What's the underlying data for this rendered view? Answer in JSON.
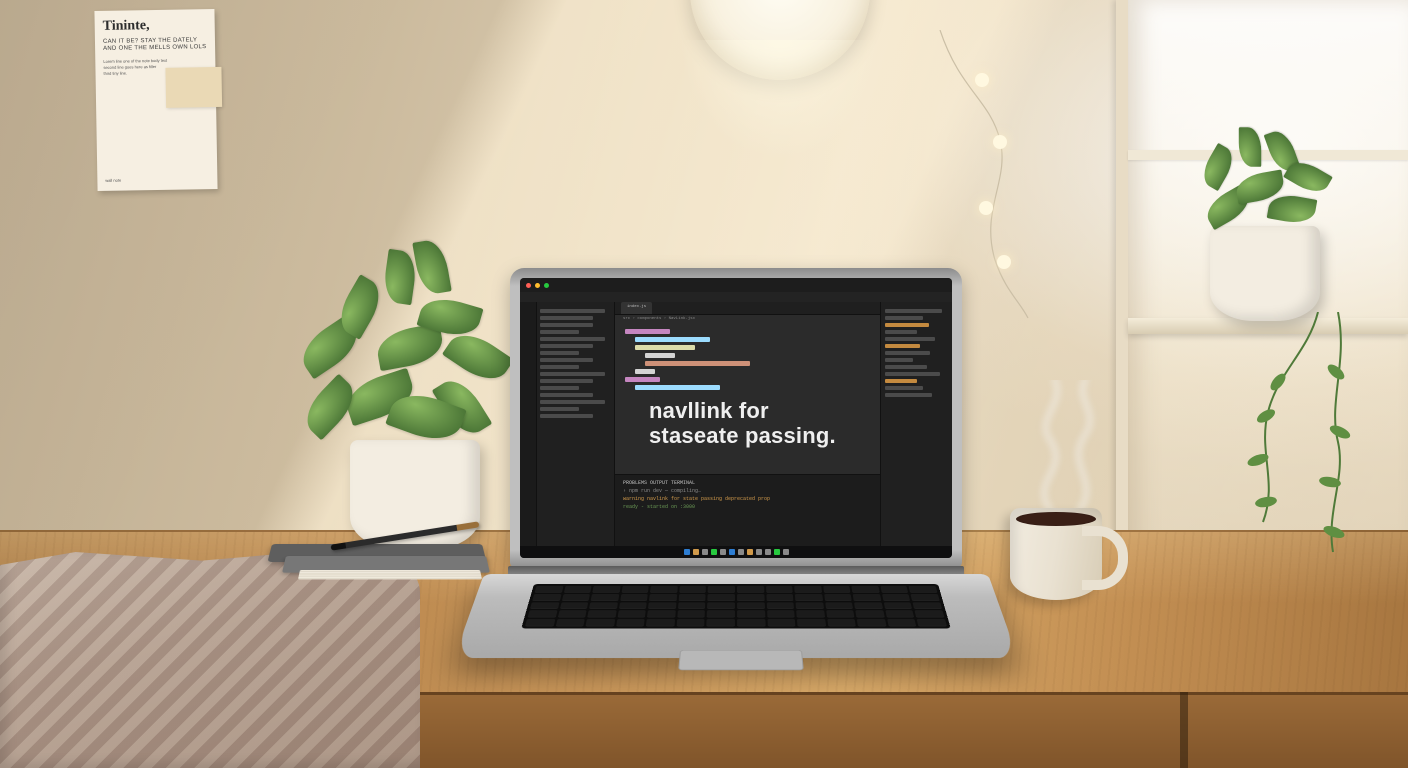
{
  "wall_note": {
    "title": "Tininte,",
    "subtitle": "CAN IT BE? STAY THE\nDATELY AND ONE THE\nMELLS OWN LOLS",
    "foot": "wall note"
  },
  "laptop": {
    "window": {
      "tab_label": "index.js"
    },
    "breadcrumb": "src › components › NavLink.jsx",
    "overlay": {
      "line1": "navllink for",
      "line2": "staseate passing."
    },
    "terminal": {
      "header": "PROBLEMS  OUTPUT  TERMINAL",
      "line1": "› npm run dev — compiling…",
      "line2": "warning  navlink for state passing  deprecated prop",
      "line3": "ready  - started on :3000"
    }
  }
}
